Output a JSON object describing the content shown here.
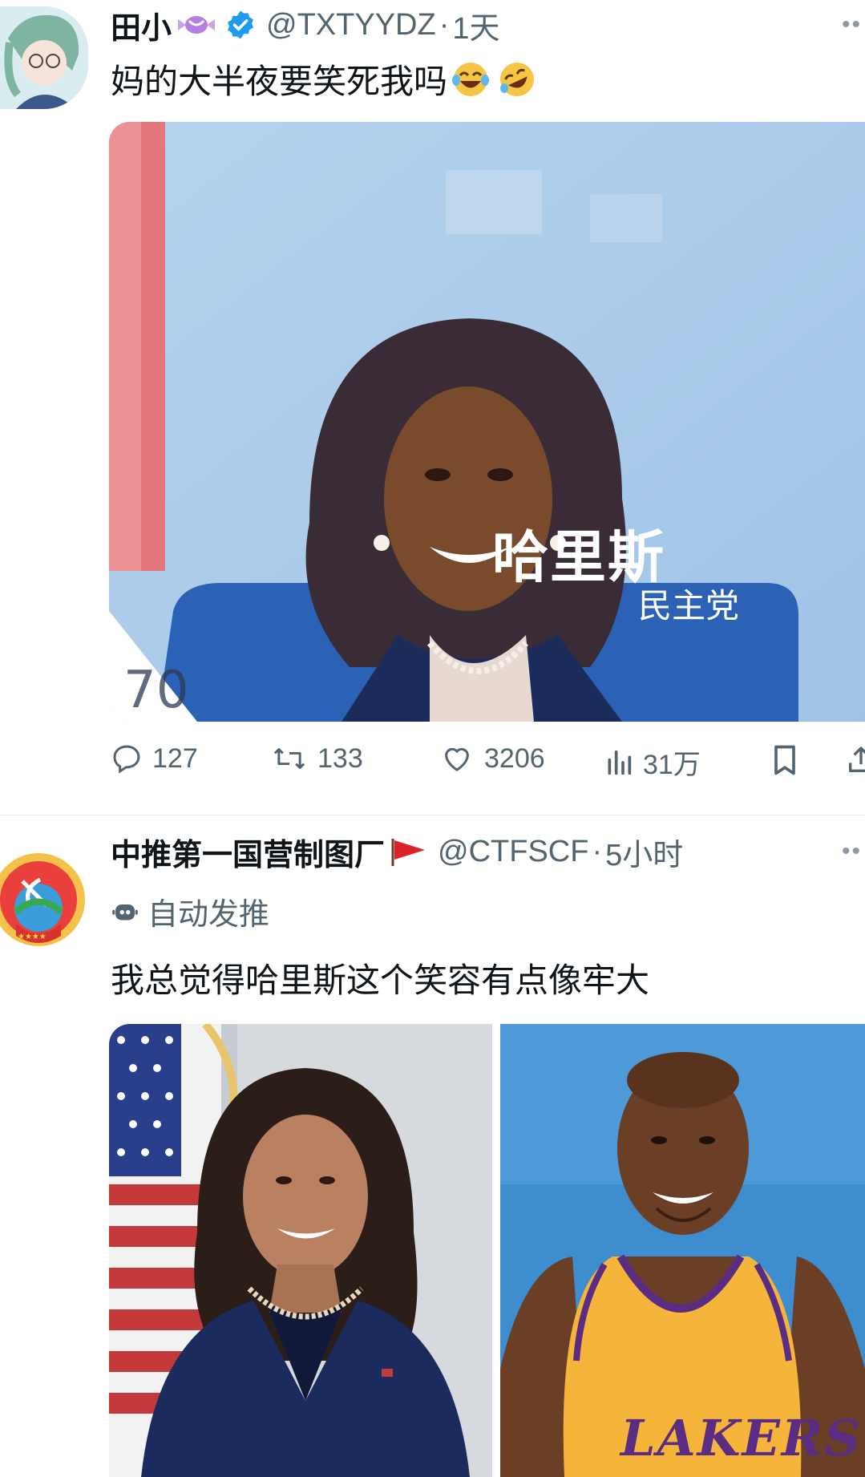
{
  "tweets": [
    {
      "author_name": "田小",
      "handle": "@TXTYYDZ",
      "time_sep": "·",
      "time": "1天",
      "text": "妈的大半夜要笑死我吗",
      "emojis": [
        "tears-of-joy-emoji",
        "rolling-on-floor-laughing-emoji"
      ],
      "media_caption_big": "哈里斯",
      "media_caption_small": "民主党",
      "media_corner_text": "70",
      "stats": {
        "replies": "127",
        "retweets": "133",
        "likes": "3206",
        "views": "31万"
      }
    },
    {
      "author_name": "中推第一国营制图厂",
      "handle": "@CTFSCF",
      "time_sep": "·",
      "time": "5小时",
      "bot_label": "自动发推",
      "text": "我总觉得哈里斯这个笑容有点像牢大",
      "media_jersey_text": "LAKERS"
    }
  ],
  "icons": {
    "verified": "verified-badge-icon",
    "reply": "reply-icon",
    "retweet": "retweet-icon",
    "like": "heart-icon",
    "views": "views-icon",
    "bookmark": "bookmark-icon",
    "share": "share-icon",
    "more": "more-icon",
    "bot": "bot-icon",
    "flag": "red-flag-icon"
  },
  "colors": {
    "verified": "#1d9bf0",
    "text_secondary": "#536471",
    "text_primary": "#0f1419"
  }
}
